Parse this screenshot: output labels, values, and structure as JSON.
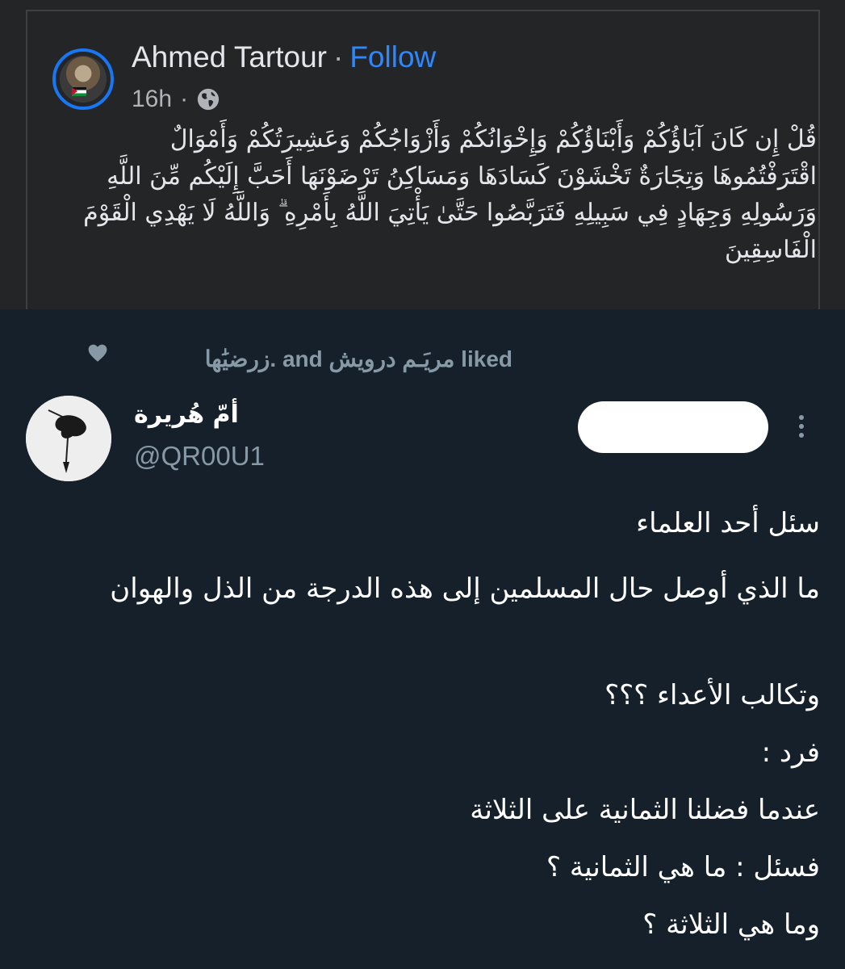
{
  "facebook_post": {
    "author": "Ahmed Tartour",
    "separator": "·",
    "follow_label": "Follow",
    "time": "16h",
    "verse": "قُلْ إِن كَانَ آبَاؤُكُمْ وَأَبْنَاؤُكُمْ وَإِخْوَانُكُمْ وَأَزْوَاجُكُمْ وَعَشِيرَتُكُمْ وَأَمْوَالٌ اقْتَرَفْتُمُوهَا وَتِجَارَةٌ تَخْشَوْنَ كَسَادَهَا وَمَسَاكِنُ تَرْضَوْنَهَا أَحَبَّ إِلَيْكُم مِّنَ اللَّهِ وَرَسُولِهِ وَجِهَادٍ فِي سَبِيلِهِ فَتَرَبَّصُوا حَتَّىٰ يَأْتِيَ اللَّهُ بِأَمْرِهِ ۗ وَاللَّهُ لَا يَهْدِي الْقَوْمَ الْفَاسِقِينَ"
  },
  "tweet": {
    "liked_by": "زرضيَٰها. and مريَـم درويش liked",
    "display_name": "أمّ هُريرة",
    "handle": "@QR00U1",
    "lines": [
      "سئل أحد العلماء",
      "ما الذي أوصل حال المسلمين إلى هذه الدرجة من الذل والهوان",
      "وتكالب الأعداء ؟؟؟",
      "فرد :",
      "عندما فضلنا الثمانية على الثلاثة",
      "فسئل : ما هي الثمانية ؟",
      "وما هي الثلاثة ؟"
    ]
  },
  "colors": {
    "fb_background": "#242526",
    "fb_follow": "#2d88ff",
    "fb_avatar_ring": "#1877f2",
    "tw_background": "#15202b",
    "tw_secondary_text": "#8899a6"
  },
  "icons": [
    "globe-icon",
    "heart-icon",
    "more-options-icon",
    "palestine-flag-icon"
  ]
}
